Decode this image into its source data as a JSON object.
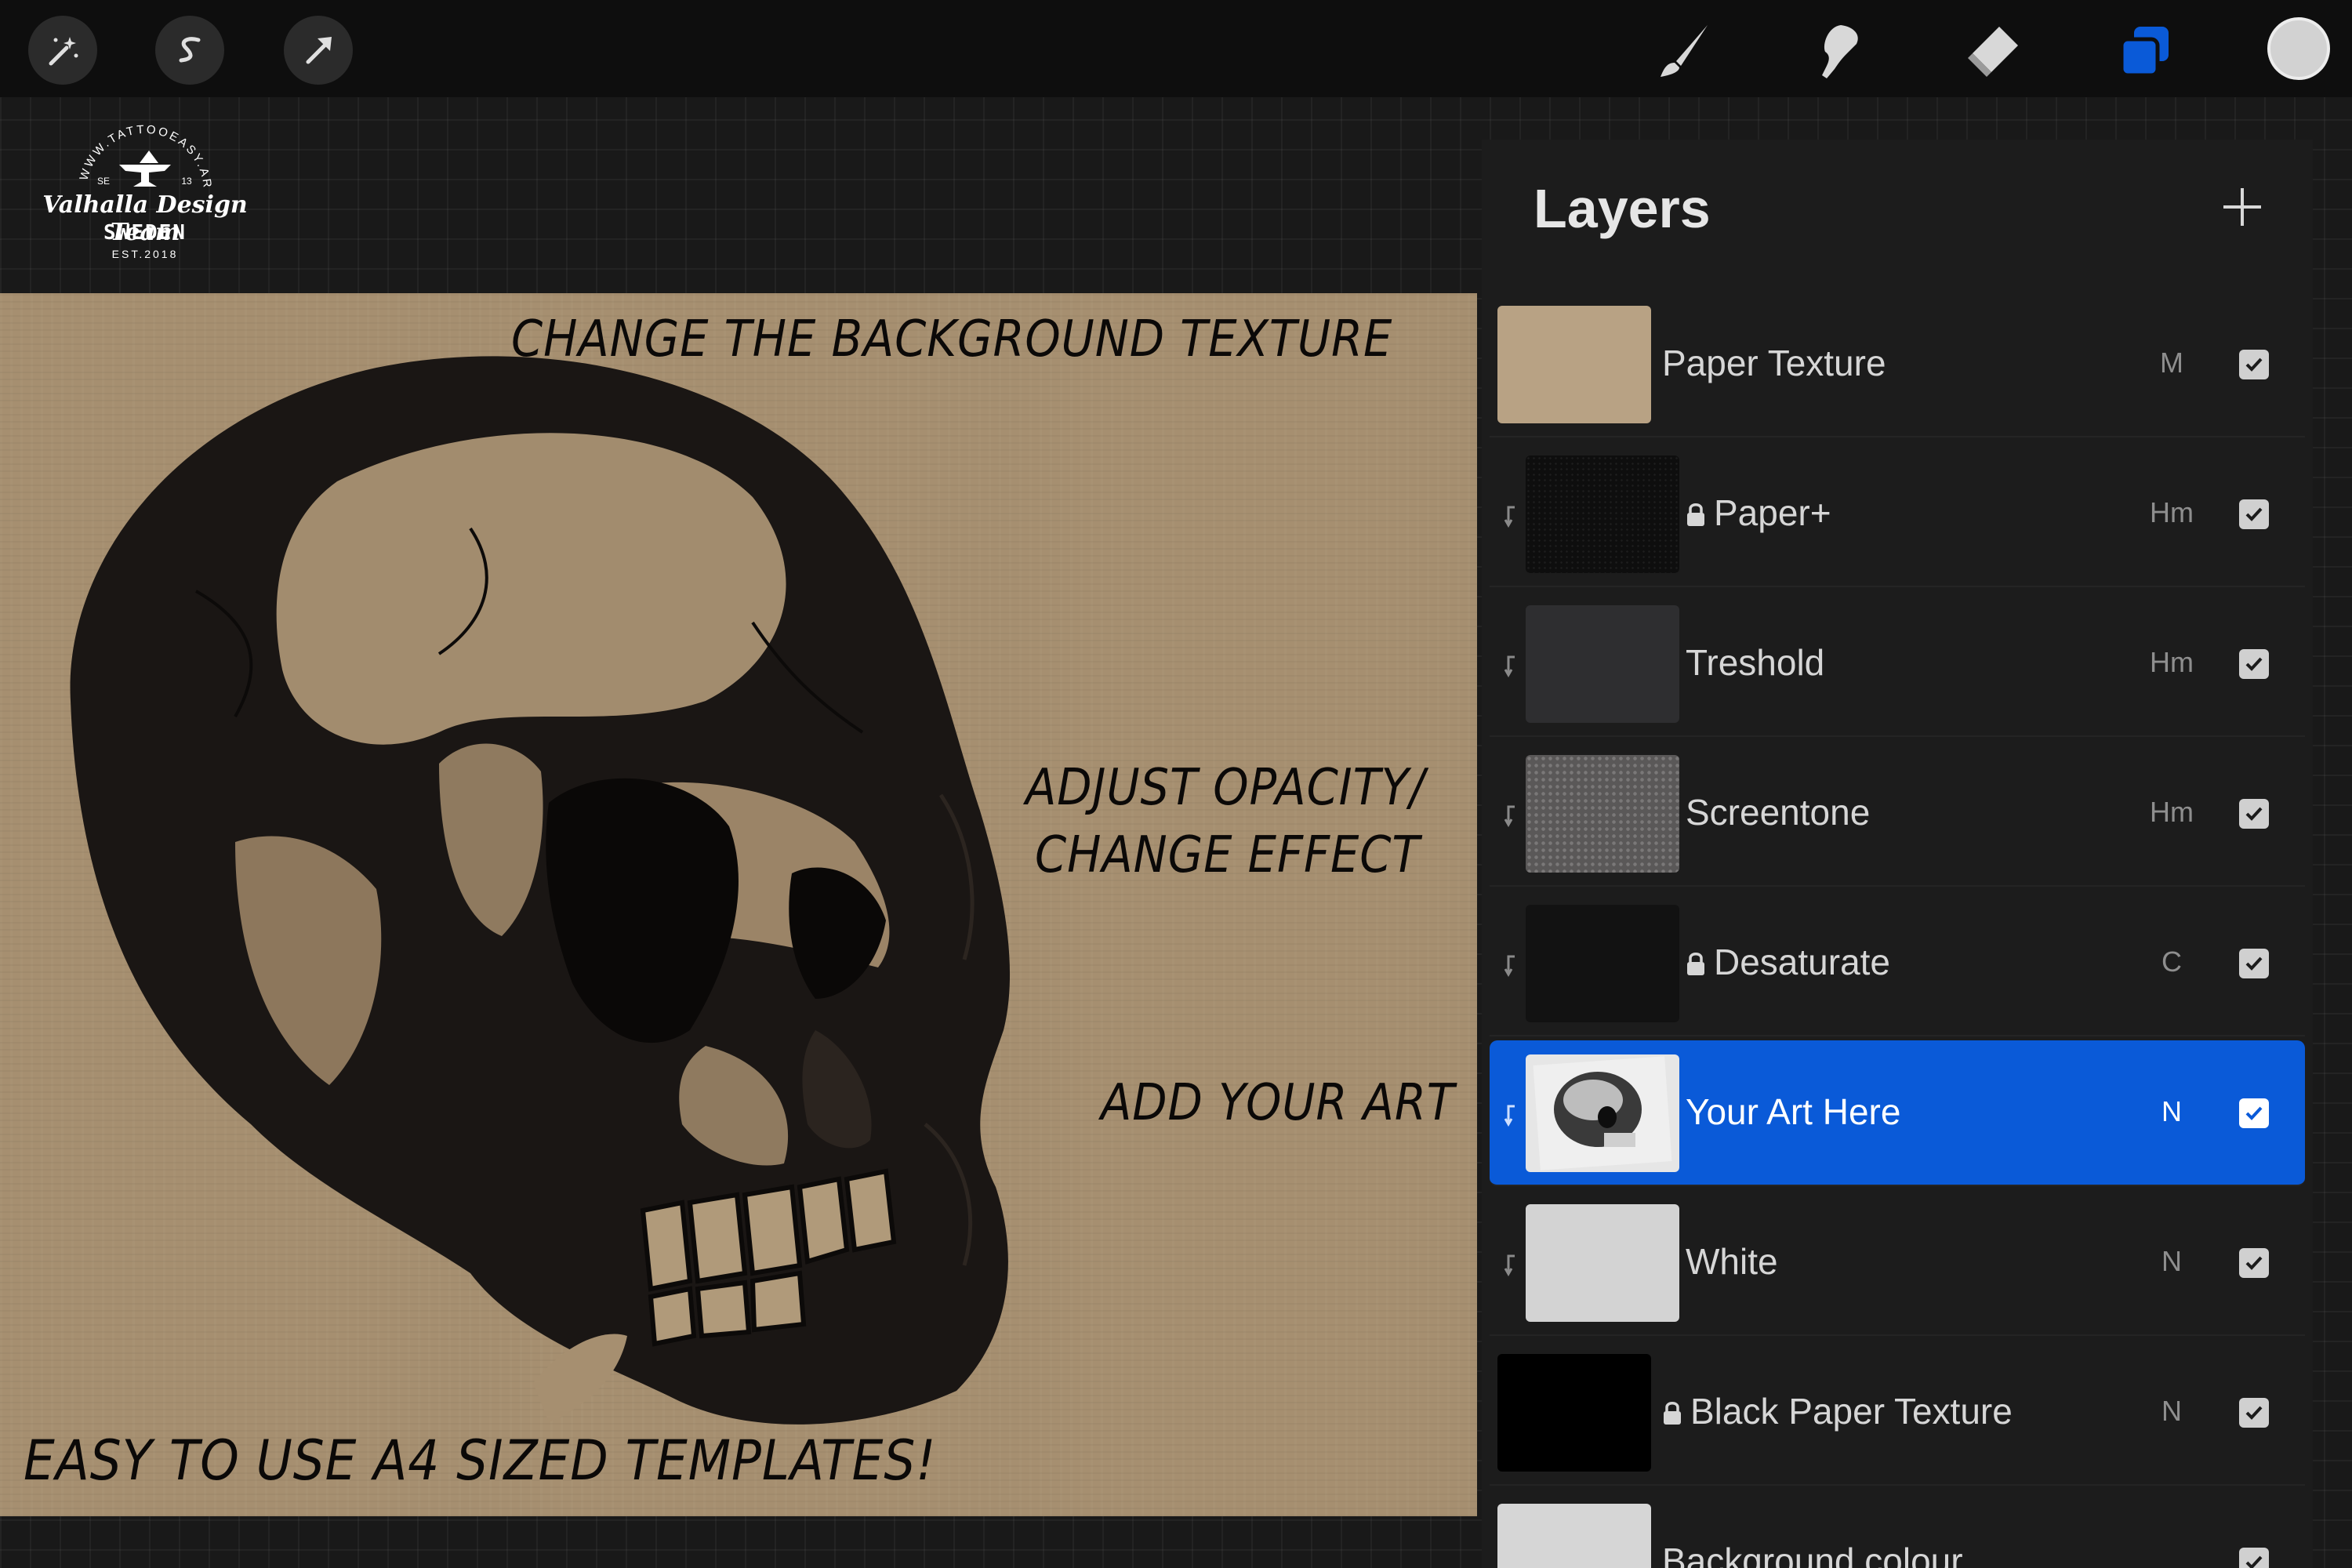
{
  "toolbar": {
    "left_tools": [
      "adjustments-icon",
      "selection-icon",
      "transform-icon"
    ],
    "right_tools": [
      "brush-icon",
      "smudge-icon",
      "eraser-icon",
      "layers-icon"
    ],
    "active_tool": "layers-icon",
    "accent_color": "#0a5ad8",
    "current_color": "#d2d2d2"
  },
  "logo": {
    "arc_text": "WWW.TATTOOEASY.ART",
    "se": "SE",
    "number": "13",
    "script": "Valhalla Design Team",
    "country": "SWEDEN",
    "est": "EST.2018"
  },
  "canvas": {
    "background_color": "#a68f70",
    "notes": {
      "background": "CHANGE THE BACKGROUND TEXTURE",
      "opacity_line1": "ADJUST OPACITY/",
      "opacity_line2": "CHANGE EFFECT",
      "art": "ADD YOUR ART",
      "templates": "EASY TO USE A4 SIZED TEMPLATES!"
    }
  },
  "layers_panel": {
    "title": "Layers",
    "add_button": "+",
    "layers": [
      {
        "name": "Paper Texture",
        "mode": "M",
        "visible": true,
        "locked": false,
        "clipped": false,
        "selected": false,
        "thumb": "tan"
      },
      {
        "name": "Paper+",
        "mode": "Hm",
        "visible": true,
        "locked": true,
        "clipped": true,
        "selected": false,
        "thumb": "black-noise"
      },
      {
        "name": "Treshold",
        "mode": "Hm",
        "visible": true,
        "locked": false,
        "clipped": true,
        "selected": false,
        "thumb": "dark-grey"
      },
      {
        "name": "Screentone",
        "mode": "Hm",
        "visible": true,
        "locked": false,
        "clipped": true,
        "selected": false,
        "thumb": "dots"
      },
      {
        "name": "Desaturate",
        "mode": "C",
        "visible": true,
        "locked": true,
        "clipped": true,
        "selected": false,
        "thumb": "near-black"
      },
      {
        "name": "Your Art Here",
        "mode": "N",
        "visible": true,
        "locked": false,
        "clipped": true,
        "selected": true,
        "thumb": "skull"
      },
      {
        "name": "White",
        "mode": "N",
        "visible": true,
        "locked": false,
        "clipped": true,
        "selected": false,
        "thumb": "light-grey"
      },
      {
        "name": "Black Paper Texture",
        "mode": "N",
        "visible": true,
        "locked": true,
        "clipped": false,
        "selected": false,
        "thumb": "black"
      },
      {
        "name": "Background colour",
        "mode": "",
        "visible": true,
        "locked": false,
        "clipped": false,
        "selected": false,
        "thumb": "white"
      }
    ]
  }
}
